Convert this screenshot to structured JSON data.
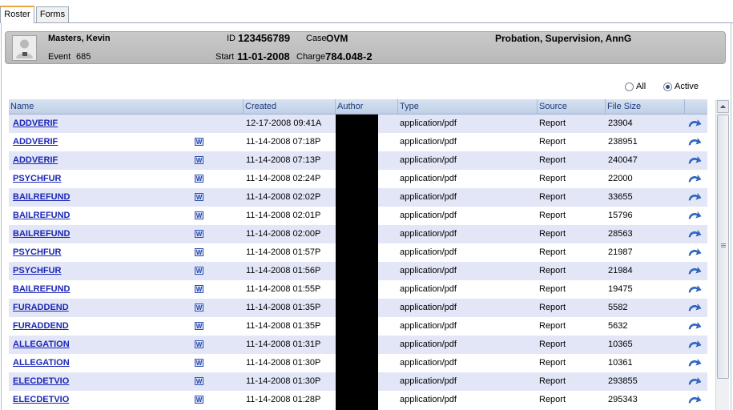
{
  "tabs": [
    {
      "label": "Roster",
      "active": true
    },
    {
      "label": "Forms",
      "active": false
    }
  ],
  "person": {
    "name": "Masters, Kevin",
    "event_label": "Event",
    "event_value": "685",
    "id_label": "ID",
    "id_value": "123456789",
    "case_label": "Case",
    "case_value": "OVM",
    "start_label": "Start",
    "start_value": "11-01-2008",
    "charge_label": "Charge",
    "charge_value": "784.048-2",
    "status": "Probation, Supervision, AnnG"
  },
  "filter": {
    "options": [
      {
        "label": "All",
        "selected": false
      },
      {
        "label": "Active",
        "selected": true
      }
    ]
  },
  "table": {
    "columns": [
      "Name",
      "Created",
      "Author",
      "Type",
      "Source",
      "File Size"
    ],
    "rows": [
      {
        "name": "ADDVERIF",
        "word": false,
        "created": "12-17-2008 09:41A",
        "type": "application/pdf",
        "source": "Report",
        "size": "23904"
      },
      {
        "name": "ADDVERIF",
        "word": true,
        "created": "11-14-2008 07:18P",
        "type": "application/pdf",
        "source": "Report",
        "size": "238951"
      },
      {
        "name": "ADDVERIF",
        "word": true,
        "created": "11-14-2008 07:13P",
        "type": "application/pdf",
        "source": "Report",
        "size": "240047"
      },
      {
        "name": "PSYCHFUR",
        "word": true,
        "created": "11-14-2008 02:24P",
        "type": "application/pdf",
        "source": "Report",
        "size": "22000"
      },
      {
        "name": "BAILREFUND",
        "word": true,
        "created": "11-14-2008 02:02P",
        "type": "application/pdf",
        "source": "Report",
        "size": "33655"
      },
      {
        "name": "BAILREFUND",
        "word": true,
        "created": "11-14-2008 02:01P",
        "type": "application/pdf",
        "source": "Report",
        "size": "15796"
      },
      {
        "name": "BAILREFUND",
        "word": true,
        "created": "11-14-2008 02:00P",
        "type": "application/pdf",
        "source": "Report",
        "size": "28563"
      },
      {
        "name": "PSYCHFUR",
        "word": true,
        "created": "11-14-2008 01:57P",
        "type": "application/pdf",
        "source": "Report",
        "size": "21987"
      },
      {
        "name": "PSYCHFUR",
        "word": true,
        "created": "11-14-2008 01:56P",
        "type": "application/pdf",
        "source": "Report",
        "size": "21984"
      },
      {
        "name": "BAILREFUND",
        "word": true,
        "created": "11-14-2008 01:55P",
        "type": "application/pdf",
        "source": "Report",
        "size": "19475"
      },
      {
        "name": "FURADDEND",
        "word": true,
        "created": "11-14-2008 01:35P",
        "type": "application/pdf",
        "source": "Report",
        "size": "5582"
      },
      {
        "name": "FURADDEND",
        "word": true,
        "created": "11-14-2008 01:35P",
        "type": "application/pdf",
        "source": "Report",
        "size": "5632"
      },
      {
        "name": "ALLEGATION",
        "word": true,
        "created": "11-14-2008 01:31P",
        "type": "application/pdf",
        "source": "Report",
        "size": "10365"
      },
      {
        "name": "ALLEGATION",
        "word": true,
        "created": "11-14-2008 01:30P",
        "type": "application/pdf",
        "source": "Report",
        "size": "10361"
      },
      {
        "name": "ELECDETVIO",
        "word": true,
        "created": "11-14-2008 01:30P",
        "type": "application/pdf",
        "source": "Report",
        "size": "293855"
      },
      {
        "name": "ELECDETVIO",
        "word": true,
        "created": "11-14-2008 01:28P",
        "type": "application/pdf",
        "source": "Report",
        "size": "295343"
      }
    ]
  },
  "icons": {
    "word_doc": "word-doc-icon",
    "open": "open-arrow-icon",
    "avatar": "person-placeholder-icon"
  },
  "colors": {
    "link": "#1b27b5",
    "alt_row": "#e3e6f7",
    "header": "#c0cfe6",
    "tab_accent": "#f0a83a"
  }
}
